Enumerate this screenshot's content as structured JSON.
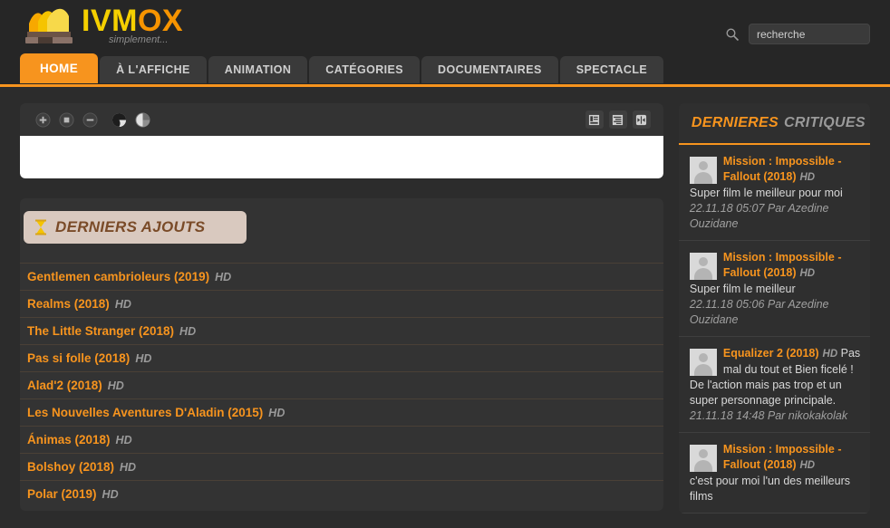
{
  "header": {
    "logo_title_part1": "IVM",
    "logo_title_part2": "OX",
    "logo_tagline": "simplement...",
    "logo_icon": "opera-house-logo",
    "search_icon": "search-icon",
    "search_placeholder": "recherche",
    "search_value": ""
  },
  "nav": {
    "tabs": [
      {
        "label": "HOME",
        "active": true
      },
      {
        "label": "À L'AFFICHE",
        "active": false
      },
      {
        "label": "ANIMATION",
        "active": false
      },
      {
        "label": "CATÉGORIES",
        "active": false
      },
      {
        "label": "DOCUMENTAIRES",
        "active": false
      },
      {
        "label": "SPECTACLE",
        "active": false
      }
    ]
  },
  "player": {
    "toolbar_left_icons": [
      "plus-circle-icon",
      "stop-square-circle-icon",
      "minus-circle-icon",
      "contrast-half-dark-icon",
      "contrast-half-light-icon"
    ],
    "toolbar_right_icons": [
      "list-layout-icon",
      "text-align-icon",
      "resize-horizontal-icon"
    ]
  },
  "latest_additions": {
    "icon": "hourglass-icon",
    "title": "DERNIERS AJOUTS",
    "quality_label": "HD",
    "items": [
      {
        "title": "Gentlemen cambrioleurs (2019)",
        "quality": "HD"
      },
      {
        "title": "Realms (2018)",
        "quality": "HD"
      },
      {
        "title": "The Little Stranger (2018)",
        "quality": "HD"
      },
      {
        "title": "Pas si folle (2018)",
        "quality": "HD"
      },
      {
        "title": "Alad'2 (2018)",
        "quality": "HD"
      },
      {
        "title": "Les Nouvelles Aventures D'Aladin (2015)",
        "quality": "HD"
      },
      {
        "title": "Ánimas (2018)",
        "quality": "HD"
      },
      {
        "title": "Bolshoy (2018)",
        "quality": "HD"
      },
      {
        "title": "Polar (2019)",
        "quality": "HD"
      }
    ]
  },
  "reviews": {
    "heading_part1": "DERNIERES",
    "heading_part2": "CRITIQUES",
    "items": [
      {
        "film": "Mission : Impossible - Fallout (2018)",
        "quality": "HD",
        "comment": "Super film le meilleur pour moi",
        "meta": "22.11.18 05:07 Par Azedine Ouzidane"
      },
      {
        "film": "Mission : Impossible - Fallout (2018)",
        "quality": "HD",
        "comment": "Super film le meilleur",
        "meta": "22.11.18 05:06 Par Azedine Ouzidane"
      },
      {
        "film": "Equalizer 2 (2018)",
        "quality": "HD",
        "comment": "Pas mal du tout et Bien ficelé ! De l'action mais pas trop et un super personnage principale.",
        "meta": "21.11.18 14:48 Par nikokakolak"
      },
      {
        "film": "Mission : Impossible - Fallout (2018)",
        "quality": "HD",
        "comment": "c'est pour moi l'un des meilleurs films",
        "meta": ""
      }
    ]
  },
  "colors": {
    "accent_orange": "#f7941e",
    "logo_yellow": "#f5d000",
    "page_bg": "#2c2c2c",
    "panel_bg": "#333333",
    "section_head_bg": "#d9c9bf",
    "section_head_text": "#7a4b28"
  }
}
